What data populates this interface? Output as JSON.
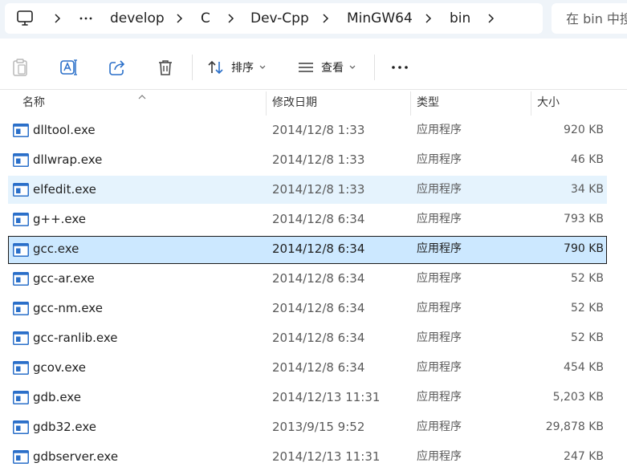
{
  "breadcrumb": {
    "items": [
      "develop",
      "C",
      "Dev-Cpp",
      "MinGW64",
      "bin"
    ]
  },
  "search": {
    "placeholder": "在 bin 中搜索"
  },
  "commands": {
    "sort_label": "排序",
    "view_label": "查看"
  },
  "columns": {
    "name": "名称",
    "date": "修改日期",
    "type": "类型",
    "size": "大小"
  },
  "files": [
    {
      "name": "dlltool.exe",
      "date": "2014/12/8 1:33",
      "type": "应用程序",
      "size": "920 KB"
    },
    {
      "name": "dllwrap.exe",
      "date": "2014/12/8 1:33",
      "type": "应用程序",
      "size": "46 KB"
    },
    {
      "name": "elfedit.exe",
      "date": "2014/12/8 1:33",
      "type": "应用程序",
      "size": "34 KB"
    },
    {
      "name": "g++.exe",
      "date": "2014/12/8 6:34",
      "type": "应用程序",
      "size": "793 KB"
    },
    {
      "name": "gcc.exe",
      "date": "2014/12/8 6:34",
      "type": "应用程序",
      "size": "790 KB"
    },
    {
      "name": "gcc-ar.exe",
      "date": "2014/12/8 6:34",
      "type": "应用程序",
      "size": "52 KB"
    },
    {
      "name": "gcc-nm.exe",
      "date": "2014/12/8 6:34",
      "type": "应用程序",
      "size": "52 KB"
    },
    {
      "name": "gcc-ranlib.exe",
      "date": "2014/12/8 6:34",
      "type": "应用程序",
      "size": "52 KB"
    },
    {
      "name": "gcov.exe",
      "date": "2014/12/8 6:34",
      "type": "应用程序",
      "size": "454 KB"
    },
    {
      "name": "gdb.exe",
      "date": "2014/12/13 11:31",
      "type": "应用程序",
      "size": "5,203 KB"
    },
    {
      "name": "gdb32.exe",
      "date": "2013/9/15 9:52",
      "type": "应用程序",
      "size": "29,878 KB"
    },
    {
      "name": "gdbserver.exe",
      "date": "2014/12/13 11:31",
      "type": "应用程序",
      "size": "247 KB"
    }
  ],
  "state": {
    "hover_file": "elfedit.exe",
    "selected_file": "gcc.exe"
  },
  "colors": {
    "selection": "#cce8ff",
    "hover": "#e5f3fd",
    "address_bar_bg": "#eff4f9",
    "exe_icon_blue": "#2a6fc9"
  },
  "icons": {
    "computer": "computer-icon",
    "more": "ellipsis-icon",
    "paste": "clipboard-icon",
    "rename": "rename-icon",
    "share": "share-icon",
    "delete": "trash-icon",
    "sort": "sort-arrows-icon",
    "view": "view-lines-icon",
    "file": "exe-file-icon"
  }
}
